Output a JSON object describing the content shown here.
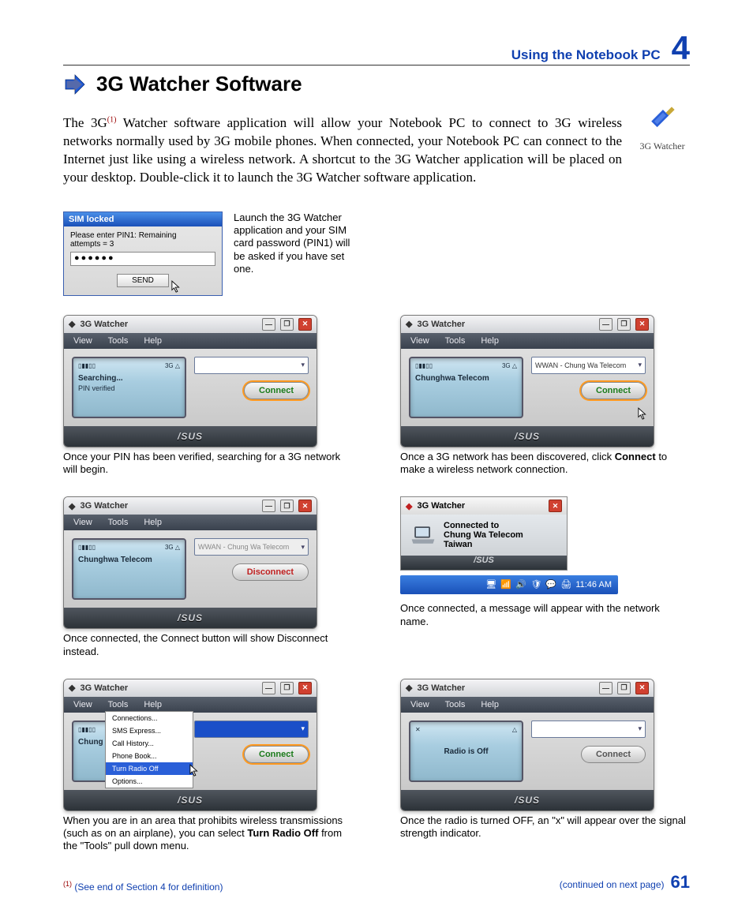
{
  "header": {
    "section": "Using the Notebook PC",
    "chapter": "4"
  },
  "title": "3G Watcher Software",
  "watcher_logo_label": "3G Watcher",
  "intro": {
    "pre": "The 3G",
    "supref": "(1)",
    "rest": " Watcher software application will allow your Notebook PC to connect to 3G wireless networks normally used by 3G mobile phones. When connected, your Notebook PC can connect to the Internet just like using a wireless network. A shortcut to the 3G Watcher application will be placed on your desktop. Double-click it to launch the 3G Watcher software application."
  },
  "sim": {
    "title": "SIM locked",
    "prompt1": "Please enter PIN1:   Remaining",
    "prompt2": "attempts = 3",
    "value": "●●●●●●",
    "send": "SEND",
    "caption": "Launch the 3G Watcher application and your SIM card password (PIN1) will be asked if you have set one."
  },
  "menus": {
    "view": "View",
    "tools": "Tools",
    "help": "Help"
  },
  "win": {
    "title": "3G Watcher",
    "brand": "/SUS"
  },
  "dropdown_items": [
    "Connections...",
    "SMS Express...",
    "Call History...",
    "Phone Book...",
    "Turn Radio Off",
    "Options..."
  ],
  "cells": [
    {
      "display": {
        "ind_left": "▯▮▮▯▯",
        "ind_right": "3G   △",
        "line1": "Searching...",
        "line2": "PIN verified"
      },
      "select": {
        "text": "",
        "state": "normal"
      },
      "button": {
        "label": "Connect",
        "style": "green ring"
      },
      "caption": "Once your PIN has been verified, searching for a 3G network will begin."
    },
    {
      "display": {
        "ind_left": "▯▮▮▯▯",
        "ind_right": "3G   △",
        "line1": "Chunghwa Telecom",
        "line2": ""
      },
      "select": {
        "text": "WWAN - Chung Wa Telecom",
        "state": "normal"
      },
      "button": {
        "label": "Connect",
        "style": "green ring cursor"
      },
      "caption_parts": [
        "Once a 3G network has been discovered, click ",
        "Connect",
        " to make a wireless network connection."
      ]
    },
    {
      "display": {
        "ind_left": "▯▮▮▯▯",
        "ind_right": "3G   △",
        "line1": "Chunghwa Telecom",
        "line2": ""
      },
      "select": {
        "text": "WWAN - Chung Wa Telecom",
        "state": "disabled"
      },
      "button": {
        "label": "Disconnect",
        "style": "red"
      },
      "caption": "Once connected, the Connect button will show Disconnect instead."
    },
    {
      "popup": {
        "title": "3G Watcher",
        "msg1": "Connected to",
        "msg2": "Chung Wa Telecom",
        "msg3": "Taiwan"
      },
      "taskbar_time": "11:46 AM",
      "caption": "Once connected, a message will appear with the network name."
    },
    {
      "display": {
        "ind_left": "▯▮▮▯▯",
        "ind_right": "3G   △",
        "line1": "Chung",
        "line2": ""
      },
      "select": {
        "text": "",
        "state": "highlight"
      },
      "button": {
        "label": "Connect",
        "style": "green ring"
      },
      "show_dropdown": true,
      "caption_parts": [
        "When you are in an area that prohibits wireless transmissions (such as on an airplane), you can select ",
        "Turn Radio Off",
        " from the \"Tools\" pull down menu."
      ]
    },
    {
      "display": {
        "ind_left": "✕",
        "ind_right": "△",
        "line1": "Radio is Off",
        "line2": ""
      },
      "select": {
        "text": "",
        "state": "normal"
      },
      "button": {
        "label": "Connect",
        "style": "gray"
      },
      "caption": "Once the radio is turned OFF, an \"x\" will appear over the signal strength indicator."
    }
  ],
  "footer": {
    "supref": "(1)",
    "left": " (See end of Section 4 for definition)",
    "right": "(continued on next page)",
    "page": "61"
  }
}
